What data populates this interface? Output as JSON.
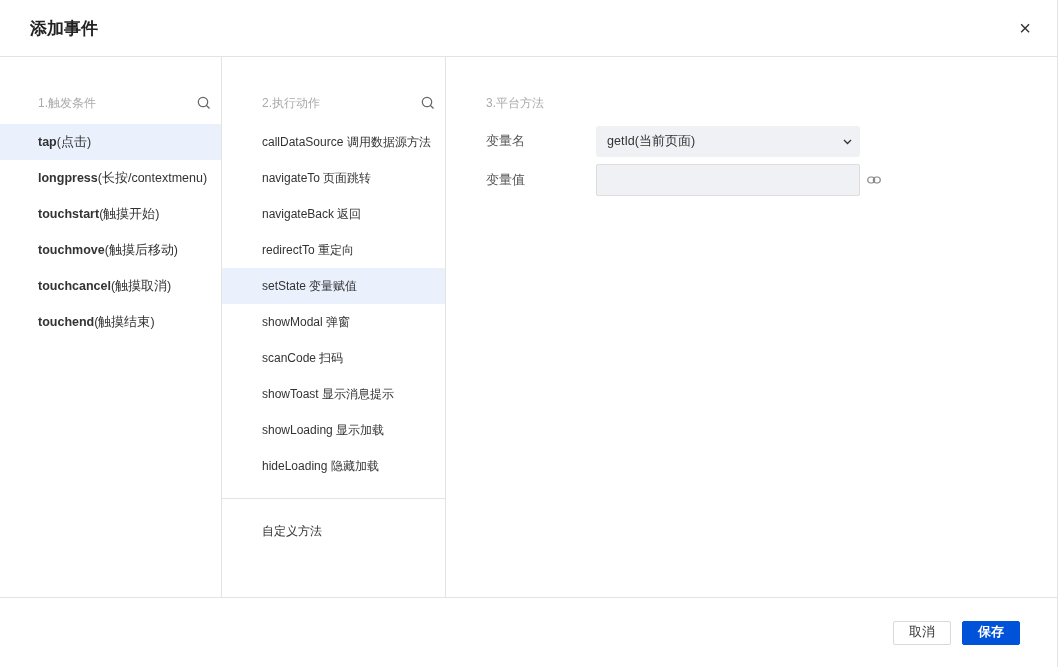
{
  "dialog": {
    "title": "添加事件",
    "close": "×"
  },
  "triggers": {
    "heading": "1.触发条件",
    "items": [
      {
        "label": "**tap**(点击)",
        "selected": true
      },
      {
        "label": "**longpress**(长按/contextmenu)",
        "selected": false
      },
      {
        "label": "**touchstart**(触摸开始)",
        "selected": false
      },
      {
        "label": "**touchmove**(触摸后移动)",
        "selected": false
      },
      {
        "label": "**touchcancel**(触摸取消)",
        "selected": false
      },
      {
        "label": "**touchend**(触摸结束)",
        "selected": false
      }
    ]
  },
  "actions": {
    "heading": "2.执行动作",
    "items": [
      {
        "label": "callDataSource 调用数据源方法",
        "selected": false
      },
      {
        "label": "navigateTo 页面跳转",
        "selected": false
      },
      {
        "label": "navigateBack 返回",
        "selected": false
      },
      {
        "label": "redirectTo 重定向",
        "selected": false
      },
      {
        "label": "setState 变量赋值",
        "selected": true
      },
      {
        "label": "showModal 弹窗",
        "selected": false
      },
      {
        "label": "scanCode 扫码",
        "selected": false
      },
      {
        "label": "showToast 显示消息提示",
        "selected": false
      },
      {
        "label": "showLoading 显示加载",
        "selected": false
      },
      {
        "label": "hideLoading 隐藏加载",
        "selected": false
      }
    ],
    "custom": {
      "label": "自定义方法",
      "selected": false
    }
  },
  "platform": {
    "heading": "3.平台方法",
    "fields": [
      {
        "kind": "select",
        "label": "变量名",
        "value": "getId(当前页面)"
      },
      {
        "kind": "input",
        "label": "变量值"
      }
    ]
  },
  "buttons": [
    {
      "label": "取消",
      "kind": "secondary"
    },
    {
      "label": "保存",
      "kind": "primary"
    }
  ]
}
